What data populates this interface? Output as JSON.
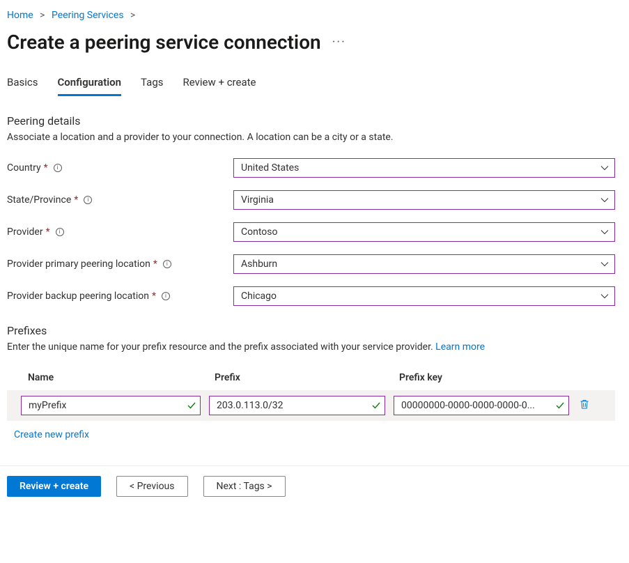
{
  "breadcrumb": {
    "home": "Home",
    "peering": "Peering Services"
  },
  "title": "Create a peering service connection",
  "tabs": {
    "basics": "Basics",
    "configuration": "Configuration",
    "tags": "Tags",
    "review": "Review + create"
  },
  "peering_details": {
    "heading": "Peering details",
    "desc": "Associate a location and a provider to your connection. A location can be a city or a state.",
    "fields": {
      "country": {
        "label": "Country",
        "value": "United States"
      },
      "state": {
        "label": "State/Province",
        "value": "Virginia"
      },
      "provider": {
        "label": "Provider",
        "value": "Contoso"
      },
      "primary": {
        "label": "Provider primary peering location",
        "value": "Ashburn"
      },
      "backup": {
        "label": "Provider backup peering location",
        "value": "Chicago"
      }
    }
  },
  "prefixes": {
    "heading": "Prefixes",
    "desc": "Enter the unique name for your prefix resource and the prefix associated with your service provider. ",
    "learn_more": "Learn more",
    "columns": {
      "name": "Name",
      "prefix": "Prefix",
      "key": "Prefix key"
    },
    "row": {
      "name": "myPrefix",
      "prefix": "203.0.113.0/32",
      "key": "00000000-0000-0000-0000-0..."
    },
    "create_new": "Create new prefix"
  },
  "footer": {
    "review_create": "Review + create",
    "previous": "< Previous",
    "next": "Next : Tags >"
  }
}
